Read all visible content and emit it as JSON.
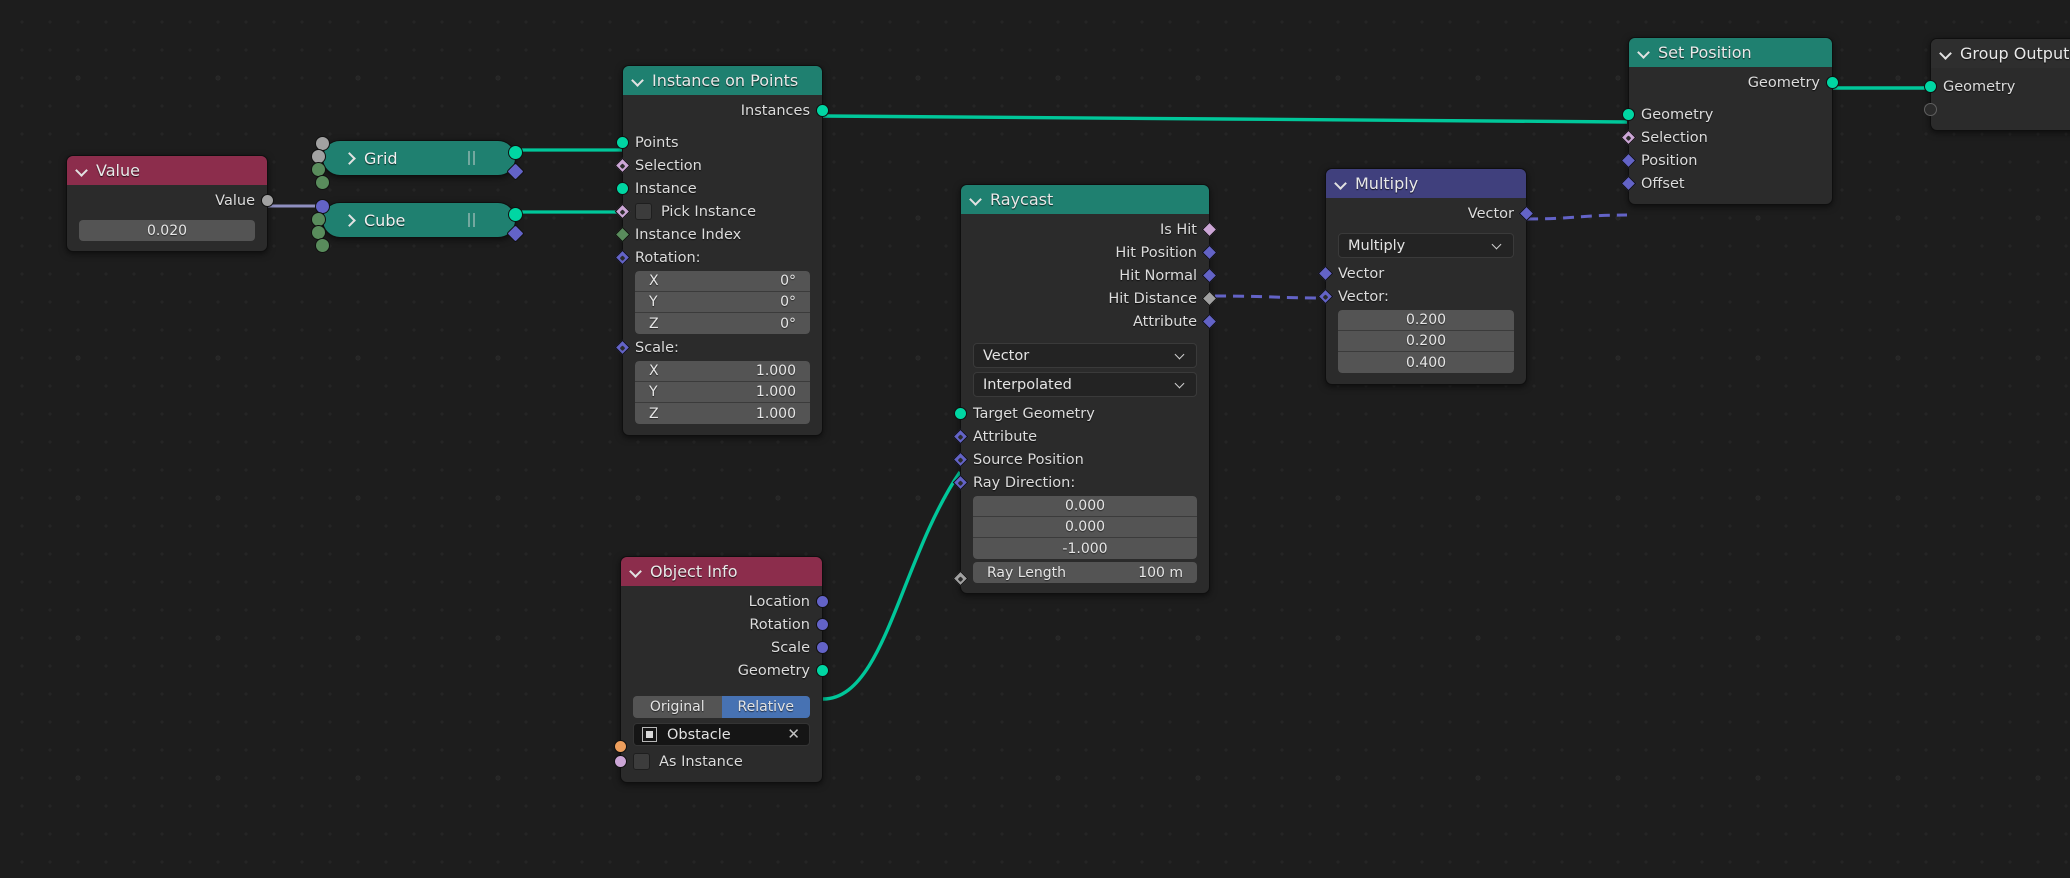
{
  "editor": {
    "name": "Blender Geometry Node Editor",
    "background_color": "#1d1d1d"
  },
  "colors": {
    "header_geometry": "#1f8070",
    "header_input": "#8c2d4c",
    "header_vector": "#40407d",
    "header_output": "#2e2e2e",
    "socket_geometry": "#00d6a3",
    "socket_boolean": "#cca6d6",
    "socket_vector": "#6363c7",
    "socket_float": "#a1a1a1",
    "socket_integer": "#598c5c",
    "socket_object": "#ed9e5c",
    "toggle_active": "#4772b3"
  },
  "nodes": {
    "value": {
      "title": "Value",
      "output_label": "Value",
      "field_value": "0.020"
    },
    "grid": {
      "title": "Grid"
    },
    "cube": {
      "title": "Cube"
    },
    "instance_on_points": {
      "title": "Instance on Points",
      "outputs": [
        {
          "label": "Instances"
        }
      ],
      "inputs": [
        {
          "label": "Points"
        },
        {
          "label": "Selection"
        },
        {
          "label": "Instance"
        },
        {
          "label": "Pick Instance"
        },
        {
          "label": "Instance Index"
        },
        {
          "label": "Rotation:"
        }
      ],
      "rotation": {
        "label": "Rotation:",
        "x_label": "X",
        "x_value": "0°",
        "y_label": "Y",
        "y_value": "0°",
        "z_label": "Z",
        "z_value": "0°"
      },
      "scale": {
        "label": "Scale:",
        "x_label": "X",
        "x_value": "1.000",
        "y_label": "Y",
        "y_value": "1.000",
        "z_label": "Z",
        "z_value": "1.000"
      }
    },
    "object_info": {
      "title": "Object Info",
      "outputs": [
        {
          "label": "Location"
        },
        {
          "label": "Rotation"
        },
        {
          "label": "Scale"
        },
        {
          "label": "Geometry"
        }
      ],
      "transform_space": {
        "original_label": "Original",
        "relative_label": "Relative",
        "selected": "Relative"
      },
      "object_field": {
        "value": "Obstacle",
        "clear_label": "✕"
      },
      "as_instance_label": "As Instance"
    },
    "raycast": {
      "title": "Raycast",
      "outputs": [
        {
          "label": "Is Hit"
        },
        {
          "label": "Hit Position"
        },
        {
          "label": "Hit Normal"
        },
        {
          "label": "Hit Distance"
        },
        {
          "label": "Attribute"
        }
      ],
      "data_type": "Vector",
      "mapping": "Interpolated",
      "inputs": [
        {
          "label": "Target Geometry"
        },
        {
          "label": "Attribute"
        },
        {
          "label": "Source Position"
        },
        {
          "label": "Ray Direction:"
        }
      ],
      "ray_direction": {
        "label": "Ray Direction:",
        "x": "0.000",
        "y": "0.000",
        "z": "-1.000"
      },
      "ray_length": {
        "label": "Ray Length",
        "value": "100 m"
      }
    },
    "multiply": {
      "title": "Multiply",
      "output_label": "Vector",
      "operation": "Multiply",
      "input_vector_label": "Vector",
      "second_vector_label": "Vector:",
      "vector_values": {
        "x": "0.200",
        "y": "0.200",
        "z": "0.400"
      }
    },
    "set_position": {
      "title": "Set Position",
      "output_label": "Geometry",
      "inputs": [
        {
          "label": "Geometry"
        },
        {
          "label": "Selection"
        },
        {
          "label": "Position"
        },
        {
          "label": "Offset"
        }
      ]
    },
    "group_output": {
      "title": "Group Output",
      "inputs": [
        {
          "label": "Geometry"
        }
      ]
    }
  }
}
